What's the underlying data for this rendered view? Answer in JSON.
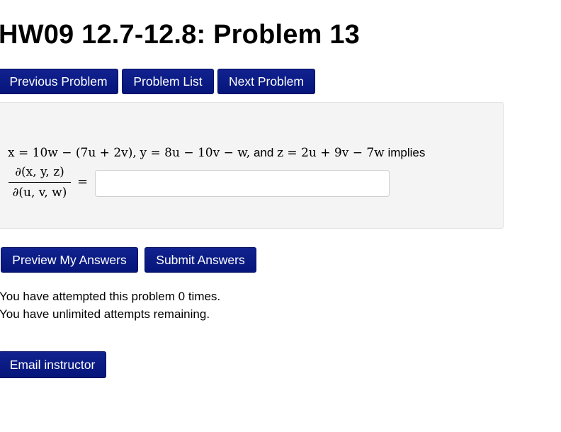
{
  "page_title": "HW09 12.7-12.8: Problem 13",
  "nav": {
    "previous_label": "Previous Problem",
    "list_label": "Problem List",
    "next_label": "Next Problem"
  },
  "problem": {
    "x_def": "x = 10w − (7u + 2v),",
    "y_def": "y = 8u − 10v − w,",
    "and_text": "and",
    "z_def": "z = 2u + 9v − 7w",
    "implies_text": "implies",
    "frac_numerator": "∂(x, y, z)",
    "frac_denominator": "∂(u, v, w)",
    "equals": "=",
    "answer_value": ""
  },
  "actions": {
    "preview_label": "Preview My Answers",
    "submit_label": "Submit Answers"
  },
  "attempts": {
    "line1": "You have attempted this problem 0 times.",
    "line2": "You have unlimited attempts remaining."
  },
  "email_label": "Email instructor",
  "colors": {
    "button_bg": "#0a1f8f",
    "problem_bg": "#f4f4f4"
  }
}
